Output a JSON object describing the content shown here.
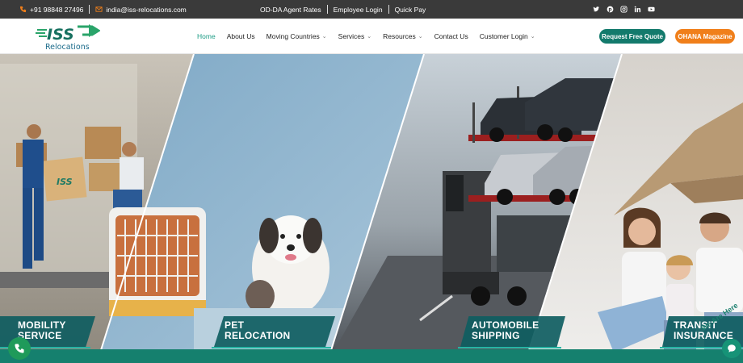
{
  "topbar": {
    "phone": "+91 98848 27496",
    "email": "india@iss-relocations.com",
    "links": [
      "OD-DA Agent Rates",
      "Employee Login",
      "Quick Pay"
    ],
    "social_icons": [
      "twitter-icon",
      "pinterest-icon",
      "instagram-icon",
      "linkedin-icon",
      "youtube-icon"
    ]
  },
  "logo": {
    "brand": "ISS",
    "sub": "Relocations"
  },
  "nav": {
    "items": [
      {
        "label": "Home",
        "dropdown": false,
        "active": true
      },
      {
        "label": "About Us",
        "dropdown": false,
        "active": false
      },
      {
        "label": "Moving Countries",
        "dropdown": true,
        "active": false
      },
      {
        "label": "Services",
        "dropdown": true,
        "active": false
      },
      {
        "label": "Resources",
        "dropdown": true,
        "active": false
      },
      {
        "label": "Contact Us",
        "dropdown": false,
        "active": false
      },
      {
        "label": "Customer Login",
        "dropdown": true,
        "active": false
      }
    ],
    "quote_button": "Request Free Quote",
    "ohana_button": "OHANA Magazine"
  },
  "hero": {
    "panels": [
      {
        "line1": "MOBILITY",
        "line2": "SERVICE"
      },
      {
        "line1": "PET",
        "line2": "RELOCATION"
      },
      {
        "line1": "AUTOMOBILE",
        "line2": "SHIPPING"
      },
      {
        "line1": "TRANSIT",
        "line2": "INSURANCE"
      }
    ],
    "box_label": "ISS"
  },
  "chat_widget": {
    "label": "We Are Here"
  },
  "colors": {
    "teal": "#137a6c",
    "orange": "#f07f1a",
    "active_nav": "#1b9b84",
    "topbar": "#3a3a3a"
  }
}
